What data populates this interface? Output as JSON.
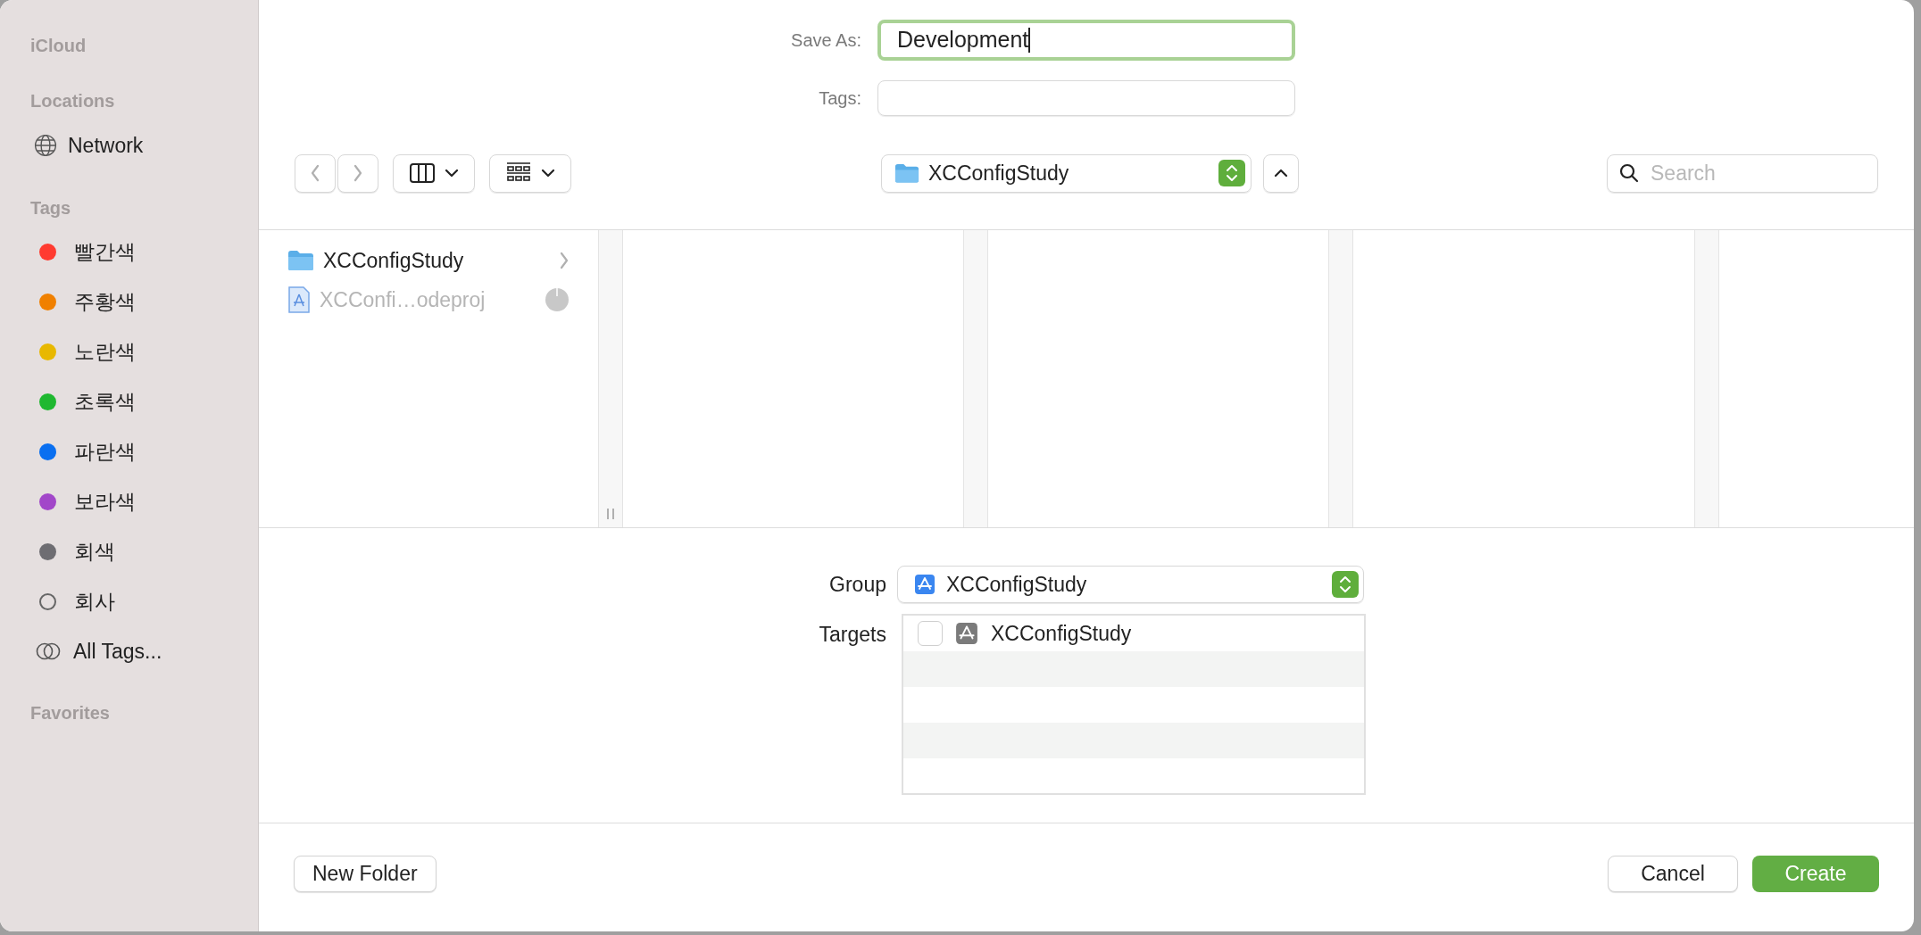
{
  "sidebar": [
    {
      "kind": "header",
      "label": "iCloud"
    },
    {
      "kind": "header",
      "label": "Locations"
    },
    {
      "kind": "network",
      "label": "Network"
    },
    {
      "kind": "header",
      "label": "Tags"
    },
    {
      "kind": "tag",
      "label": "빨간색",
      "color": "#ff3b30"
    },
    {
      "kind": "tag",
      "label": "주황색",
      "color": "#f08000"
    },
    {
      "kind": "tag",
      "label": "노란색",
      "color": "#e8b800"
    },
    {
      "kind": "tag",
      "label": "초록색",
      "color": "#1fb830"
    },
    {
      "kind": "tag",
      "label": "파란색",
      "color": "#0a6ff0"
    },
    {
      "kind": "tag",
      "label": "보라색",
      "color": "#a247c9"
    },
    {
      "kind": "tag",
      "label": "회색",
      "color": "#6e6d72"
    },
    {
      "kind": "hollow_tag",
      "label": "회사"
    },
    {
      "kind": "all_tags",
      "label": "All Tags..."
    },
    {
      "kind": "header",
      "label": "Favorites"
    }
  ],
  "save_as": {
    "label": "Save As:",
    "value": "Development"
  },
  "tags": {
    "label": "Tags:"
  },
  "toolbar": {
    "back": {
      "disabled": true
    },
    "forward": {
      "disabled": true
    },
    "location": "XCConfigStudy",
    "search": {
      "placeholder": "Search"
    }
  },
  "browser": {
    "items": [
      {
        "kind": "folder",
        "name": "XCConfigStudy",
        "disabled": false
      },
      {
        "kind": "project",
        "name": "XCConfi…odeproj",
        "disabled": true
      }
    ]
  },
  "group": {
    "label": "Group",
    "value": "XCConfigStudy"
  },
  "targets": {
    "label": "Targets",
    "items": [
      {
        "name": "XCConfigStudy",
        "checked": false
      }
    ]
  },
  "buttons": [
    {
      "kind": "plain",
      "label": "New Folder"
    },
    {
      "kind": "plain",
      "label": "Cancel"
    },
    {
      "kind": "primary",
      "label": "Create"
    }
  ]
}
